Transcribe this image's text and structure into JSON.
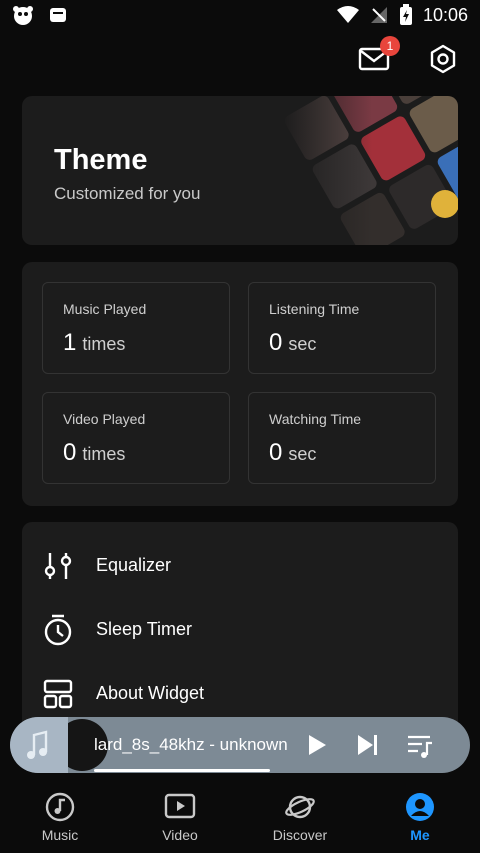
{
  "status_bar": {
    "time": "10:06"
  },
  "header": {
    "mail_badge_count": "1",
    "mail_icon": "mail-icon",
    "settings_icon": "gear-icon"
  },
  "theme_card": {
    "title": "Theme",
    "subtitle": "Customized for you"
  },
  "stats": [
    {
      "label": "Music Played",
      "value": "1",
      "unit": "times"
    },
    {
      "label": "Listening Time",
      "value": "0",
      "unit": "sec"
    },
    {
      "label": "Video Played",
      "value": "0",
      "unit": "times"
    },
    {
      "label": "Watching Time",
      "value": "0",
      "unit": "sec"
    }
  ],
  "menu": [
    {
      "label": "Equalizer",
      "icon": "equalizer-icon"
    },
    {
      "label": "Sleep Timer",
      "icon": "timer-icon"
    },
    {
      "label": "About Widget",
      "icon": "widget-icon"
    }
  ],
  "player": {
    "track_title": "lard_8s_48khz - unknown",
    "progress": 0.5
  },
  "bottom_nav": [
    {
      "label": "Music",
      "icon": "music-note-icon",
      "active": false
    },
    {
      "label": "Video",
      "icon": "video-icon",
      "active": false
    },
    {
      "label": "Discover",
      "icon": "planet-icon",
      "active": false
    },
    {
      "label": "Me",
      "icon": "profile-icon",
      "active": true
    }
  ],
  "colors": {
    "accent": "#1e96ff",
    "badge": "#e8453c",
    "card": "#1c1c1c",
    "background": "#0b0b0b"
  }
}
